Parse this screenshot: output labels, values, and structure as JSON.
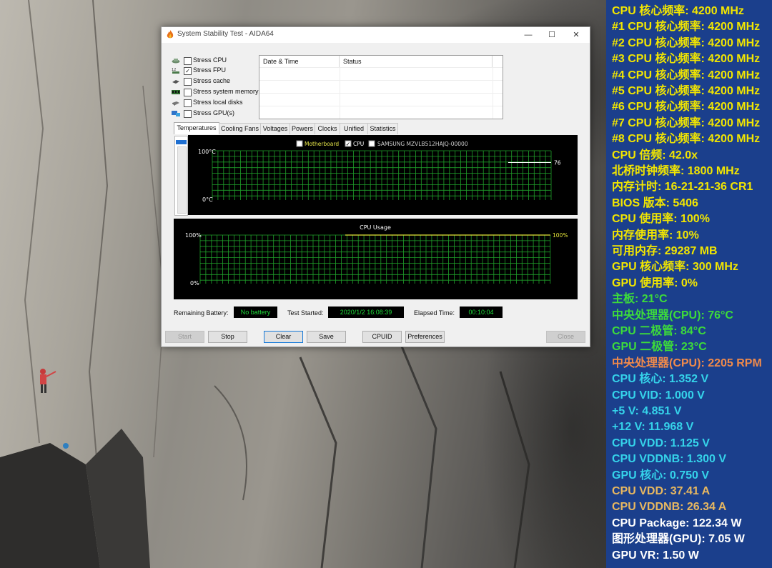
{
  "window": {
    "title": "System Stability Test - AIDA64",
    "minimize": "—",
    "maximize": "☐",
    "close": "✕"
  },
  "stress_options": [
    {
      "label": "Stress CPU",
      "checked": false,
      "icon": "cpu-chip-icon"
    },
    {
      "label": "Stress FPU",
      "checked": true,
      "icon": "fpu-icon"
    },
    {
      "label": "Stress cache",
      "checked": false,
      "icon": "cache-icon"
    },
    {
      "label": "Stress system memory",
      "checked": false,
      "icon": "memory-module-icon"
    },
    {
      "label": "Stress local disks",
      "checked": false,
      "icon": "disk-icon"
    },
    {
      "label": "Stress GPU(s)",
      "checked": false,
      "icon": "gpu-icon"
    }
  ],
  "status_table": {
    "columns": [
      "Date & Time",
      "Status"
    ]
  },
  "tabs": [
    "Temperatures",
    "Cooling Fans",
    "Voltages",
    "Powers",
    "Clocks",
    "Unified",
    "Statistics"
  ],
  "active_tab": "Temperatures",
  "temp_graph": {
    "legend": [
      {
        "label": "Motherboard",
        "checked": false,
        "color": "#e8e84a"
      },
      {
        "label": "CPU",
        "checked": true,
        "color": "#ffffff"
      },
      {
        "label": "SAMSUNG MZVLB512HAJQ-00000",
        "checked": false,
        "color": "#cfcfcf"
      }
    ],
    "y_max_label": "100°C",
    "y_min_label": "0°C",
    "cpu_value_label": "76",
    "cpu_value": 76
  },
  "cpu_graph": {
    "title": "CPU Usage",
    "y_max_label": "100%",
    "y_min_label": "0%",
    "value_label": "100%",
    "value": 100
  },
  "footer": {
    "battery_label": "Remaining Battery:",
    "battery_value": "No battery",
    "started_label": "Test Started:",
    "started_value": "2020/1/2 16:08:39",
    "elapsed_label": "Elapsed Time:",
    "elapsed_value": "00:10:04"
  },
  "buttons": {
    "start": "Start",
    "stop": "Stop",
    "clear": "Clear",
    "save": "Save",
    "cpuid": "CPUID",
    "preferences": "Preferences",
    "close": "Close"
  },
  "osd": [
    {
      "text": "CPU 核心频率: 4200 MHz",
      "color": "#f2e600"
    },
    {
      "text": "#1 CPU 核心频率: 4200 MHz",
      "color": "#f2e600"
    },
    {
      "text": "#2 CPU 核心频率: 4200 MHz",
      "color": "#f2e600"
    },
    {
      "text": "#3 CPU 核心频率: 4200 MHz",
      "color": "#f2e600"
    },
    {
      "text": "#4 CPU 核心频率: 4200 MHz",
      "color": "#f2e600"
    },
    {
      "text": "#5 CPU 核心频率: 4200 MHz",
      "color": "#f2e600"
    },
    {
      "text": "#6 CPU 核心频率: 4200 MHz",
      "color": "#f2e600"
    },
    {
      "text": "#7 CPU 核心频率: 4200 MHz",
      "color": "#f2e600"
    },
    {
      "text": "#8 CPU 核心频率: 4200 MHz",
      "color": "#f2e600"
    },
    {
      "text": "CPU 倍频: 42.0x",
      "color": "#f2e600"
    },
    {
      "text": "北桥时钟频率: 1800 MHz",
      "color": "#f2e600"
    },
    {
      "text": "内存计时: 16-21-21-36 CR1",
      "color": "#f2e600"
    },
    {
      "text": "BIOS 版本: 5406",
      "color": "#f2e600"
    },
    {
      "text": "CPU 使用率: 100%",
      "color": "#f2e600"
    },
    {
      "text": "内存使用率: 10%",
      "color": "#f2e600"
    },
    {
      "text": "可用内存: 29287 MB",
      "color": "#f2e600"
    },
    {
      "text": "GPU 核心频率: 300 MHz",
      "color": "#f2e600"
    },
    {
      "text": "GPU 使用率: 0%",
      "color": "#f2e600"
    },
    {
      "text": "主板: 21°C",
      "color": "#3ddc3a"
    },
    {
      "text": "中央处理器(CPU): 76°C",
      "color": "#3ddc3a"
    },
    {
      "text": "CPU 二极管: 84°C",
      "color": "#3ddc3a"
    },
    {
      "text": "GPU 二极管: 23°C",
      "color": "#3ddc3a"
    },
    {
      "text": "中央处理器(CPU): 2205 RPM",
      "color": "#f08a4b"
    },
    {
      "text": "CPU 核心: 1.352 V",
      "color": "#35d3ea"
    },
    {
      "text": "CPU VID: 1.000 V",
      "color": "#35d3ea"
    },
    {
      "text": "+5 V: 4.851 V",
      "color": "#35d3ea"
    },
    {
      "text": "+12 V: 11.968 V",
      "color": "#35d3ea"
    },
    {
      "text": "CPU VDD: 1.125 V",
      "color": "#35d3ea"
    },
    {
      "text": "CPU VDDNB: 1.300 V",
      "color": "#35d3ea"
    },
    {
      "text": "GPU 核心: 0.750 V",
      "color": "#35d3ea"
    },
    {
      "text": "CPU VDD: 37.41 A",
      "color": "#e8b860"
    },
    {
      "text": "CPU VDDNB: 26.34 A",
      "color": "#e8b860"
    },
    {
      "text": "CPU Package: 122.34 W",
      "color": "#ffffff"
    },
    {
      "text": "图形处理器(GPU): 7.05 W",
      "color": "#ffffff"
    },
    {
      "text": "GPU VR: 1.50 W",
      "color": "#ffffff"
    }
  ]
}
